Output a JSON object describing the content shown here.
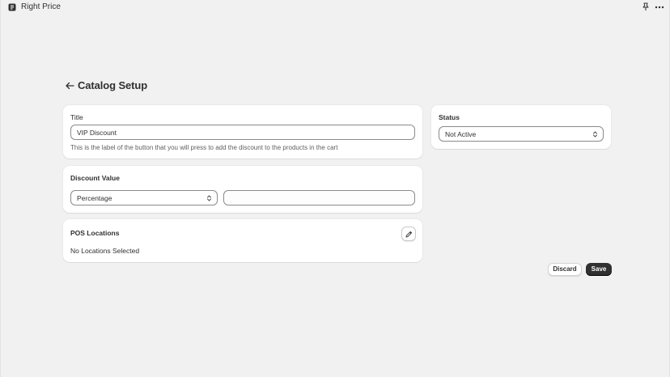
{
  "app": {
    "title": "Right Price",
    "icons": {
      "app": "app-logo-icon",
      "pin": "pin-icon",
      "more": "more-horizontal-icon"
    }
  },
  "header": {
    "back_icon": "arrow-left-icon",
    "title": "Catalog Setup"
  },
  "title_card": {
    "label": "Title",
    "value": "VIP Discount",
    "help": "This is the label of the button that you will press to add the discount to the products in the cart"
  },
  "status_card": {
    "label": "Status",
    "selected": "Not Active"
  },
  "discount_card": {
    "label": "Discount Value",
    "type_selected": "Percentage",
    "amount_value": ""
  },
  "locations_card": {
    "label": "POS Locations",
    "value": "No Locations Selected",
    "edit_icon": "pencil-icon"
  },
  "actions": {
    "discard_label": "Discard",
    "save_label": "Save"
  },
  "colors": {
    "background": "#f1f1f1",
    "card": "#ffffff",
    "text": "#303030",
    "primary_button": "#303030"
  }
}
